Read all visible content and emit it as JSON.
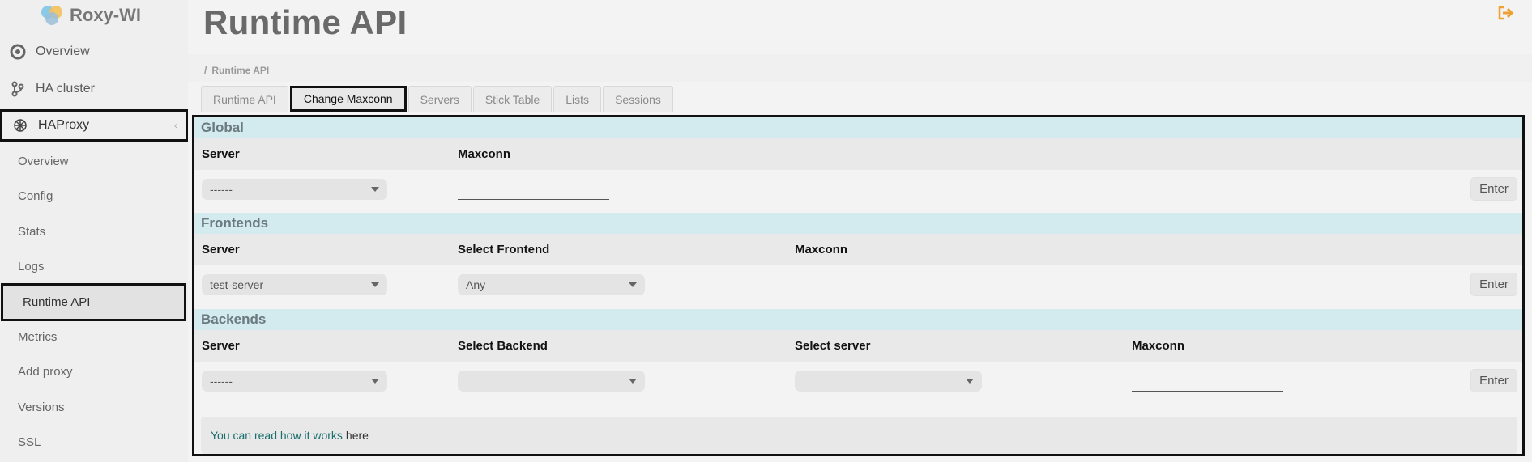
{
  "app": {
    "name": "Roxy-WI"
  },
  "sidebar": {
    "items": [
      {
        "label": "Overview",
        "icon": "overview-icon"
      },
      {
        "label": "HA cluster",
        "icon": "git-branch-icon"
      },
      {
        "label": "HAProxy",
        "icon": "haproxy-icon"
      }
    ],
    "sub_items": [
      {
        "label": "Overview"
      },
      {
        "label": "Config"
      },
      {
        "label": "Stats"
      },
      {
        "label": "Logs"
      },
      {
        "label": "Runtime API"
      },
      {
        "label": "Metrics"
      },
      {
        "label": "Add proxy"
      },
      {
        "label": "Versions"
      },
      {
        "label": "SSL"
      }
    ]
  },
  "page": {
    "title": "Runtime API",
    "breadcrumb": "Runtime API"
  },
  "tabs": [
    {
      "label": "Runtime API"
    },
    {
      "label": "Change Maxconn"
    },
    {
      "label": "Servers"
    },
    {
      "label": "Stick Table"
    },
    {
      "label": "Lists"
    },
    {
      "label": "Sessions"
    }
  ],
  "sections": {
    "global": {
      "title": "Global",
      "server_label": "Server",
      "maxconn_label": "Maxconn",
      "server_value": "------",
      "enter_label": "Enter"
    },
    "frontends": {
      "title": "Frontends",
      "server_label": "Server",
      "frontend_label": "Select Frontend",
      "maxconn_label": "Maxconn",
      "server_value": "test-server",
      "frontend_value": "Any",
      "enter_label": "Enter"
    },
    "backends": {
      "title": "Backends",
      "server_label": "Server",
      "backend_label": "Select Backend",
      "select_server_label": "Select server",
      "maxconn_label": "Maxconn",
      "server_value": "------",
      "backend_value": "",
      "select_server_value": "",
      "enter_label": "Enter"
    }
  },
  "footer": {
    "link_text": "You can read how it works",
    "suffix": "here"
  },
  "colors": {
    "section_bg": "#d3eaee",
    "accent_orange": "#f0a030",
    "link_teal": "#1b6e6e"
  }
}
